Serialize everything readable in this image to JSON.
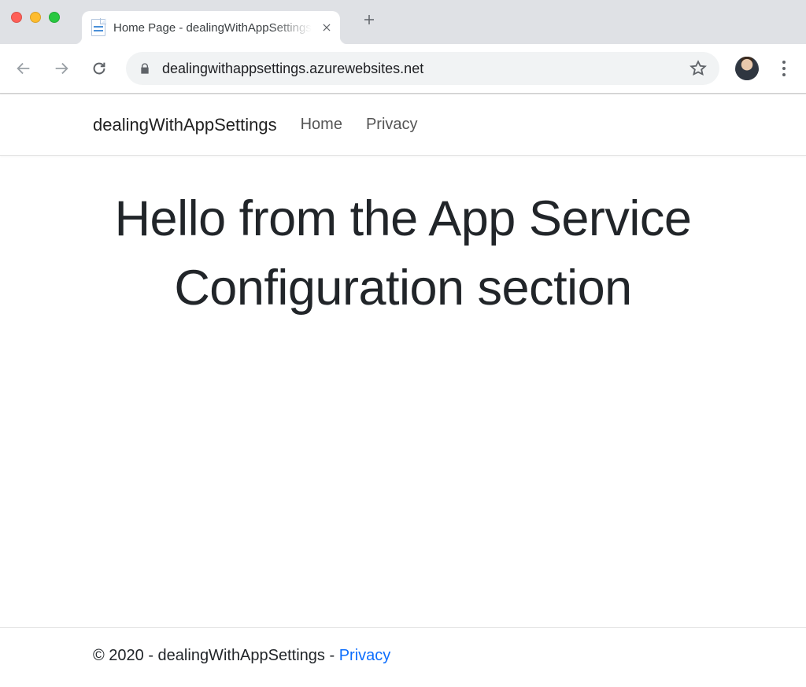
{
  "chrome": {
    "tab_title": "Home Page - dealingWithAppSettings",
    "url": "dealingwithappsettings.azurewebsites.net"
  },
  "navbar": {
    "brand": "dealingWithAppSettings",
    "links": [
      "Home",
      "Privacy"
    ]
  },
  "main": {
    "hero": "Hello from the App Service Configuration section"
  },
  "footer": {
    "copyright": "© 2020 - dealingWithAppSettings - ",
    "privacy_link": "Privacy"
  }
}
